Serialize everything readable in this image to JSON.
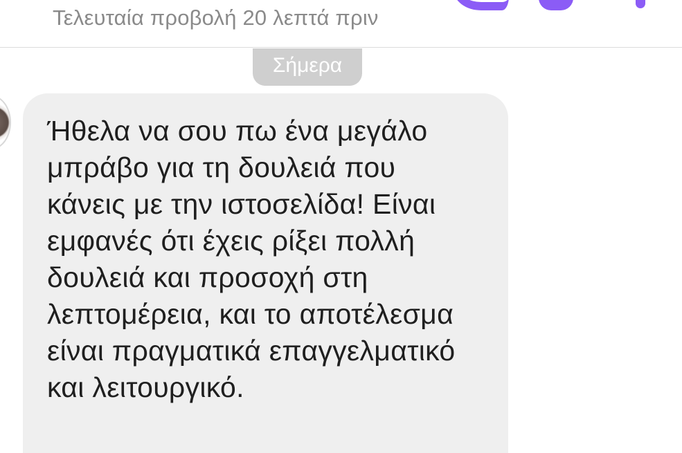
{
  "header": {
    "last_seen": "Τελευταία προβολή 20 λεπτά πριν",
    "icons": [
      "action-icon-video",
      "action-icon-call",
      "more-options-icon"
    ],
    "accent_color": "#8b5cf6"
  },
  "chat": {
    "date_separator": "Σήμερα",
    "messages": [
      {
        "sender": "contact",
        "text": "Ήθελα να σου πω ένα μεγάλο μπράβο για τη δουλειά που κάνεις με την ιστοσελίδα! Είναι εμφανές ότι έχεις ρίξει πολλή δουλειά και προσοχή στη λεπτομέρεια, και το αποτέλεσμα είναι πραγματικά επαγγελματικό και λειτουργικό."
      }
    ]
  }
}
